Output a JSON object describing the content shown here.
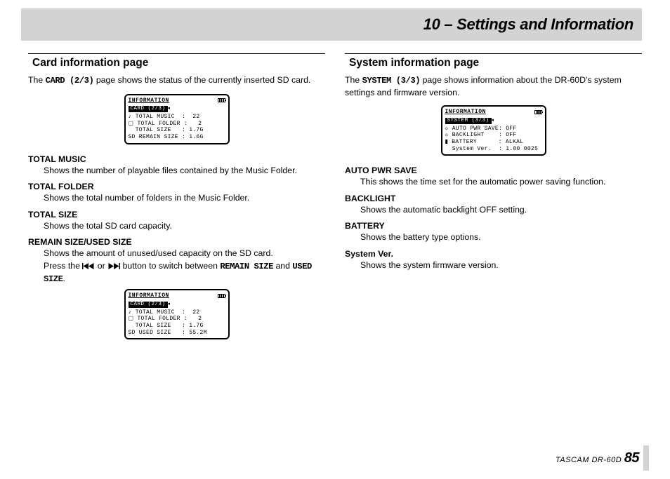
{
  "chapter_title": "10 – Settings and Information",
  "left": {
    "section_title": "Card information page",
    "intro_pre": "The ",
    "intro_code": "CARD (2/3)",
    "intro_post": " page shows the status of the currently inserted SD card.",
    "lcd1_title": "INFORMATION",
    "lcd1_sub": "CARD  (2/3)",
    "lcd1_l1": "♪ TOTAL MUSIC  :  22",
    "lcd1_l2": "▢ TOTAL FOLDER :   2",
    "lcd1_l3": "  TOTAL SIZE   : 1.7G",
    "lcd1_l4": "SD REMAIN SIZE : 1.6G",
    "t1_term": "TOTAL MUSIC",
    "t1_desc": "Shows the number of playable files contained by the Music Folder.",
    "t2_term": "TOTAL FOLDER",
    "t2_desc": "Shows the total number of folders in the Music Folder.",
    "t3_term": "TOTAL SIZE",
    "t3_desc": "Shows the total SD card capacity.",
    "t4_term": "REMAIN SIZE/USED SIZE",
    "t4_desc1": "Shows the amount of unused/used capacity on the SD card.",
    "t4_desc2a": "Press the ",
    "t4_desc2b": " or ",
    "t4_desc2c": " button to switch between ",
    "t4_code1": "REMAIN SIZE",
    "t4_desc2d": " and ",
    "t4_code2": "USED SIZE",
    "t4_desc2e": ".",
    "lcd2_title": "INFORMATION",
    "lcd2_sub": "CARD  (2/3)",
    "lcd2_l1": "♪ TOTAL MUSIC  :  22",
    "lcd2_l2": "▢ TOTAL FOLDER :   2",
    "lcd2_l3": "  TOTAL SIZE   : 1.7G",
    "lcd2_l4": "SD USED SIZE   : 55.2M"
  },
  "right": {
    "section_title": "System information page",
    "intro_pre": "The ",
    "intro_code": "SYSTEM (3/3)",
    "intro_post": " page shows information about the DR-60D's system settings and firmware version.",
    "lcd_title": "INFORMATION",
    "lcd_sub": "SYSTEM (3/3)",
    "lcd_l1": "☼ AUTO PWR SAVE: OFF",
    "lcd_l2": "☼ BACKLIGHT    : OFF",
    "lcd_l3": "▮ BATTERY      : ALKAL",
    "lcd_l4": "  System Ver.  : 1.00 0025",
    "t1_term": "AUTO PWR SAVE",
    "t1_desc": "This shows the time set for the automatic power saving function.",
    "t2_term": "BACKLIGHT",
    "t2_desc": "Shows the automatic backlight OFF setting.",
    "t3_term": "BATTERY",
    "t3_desc": "Shows the battery type options.",
    "t4_term": "System Ver.",
    "t4_desc": "Shows the system firmware version."
  },
  "footer_brand": "TASCAM  DR-60D ",
  "footer_page": "85"
}
